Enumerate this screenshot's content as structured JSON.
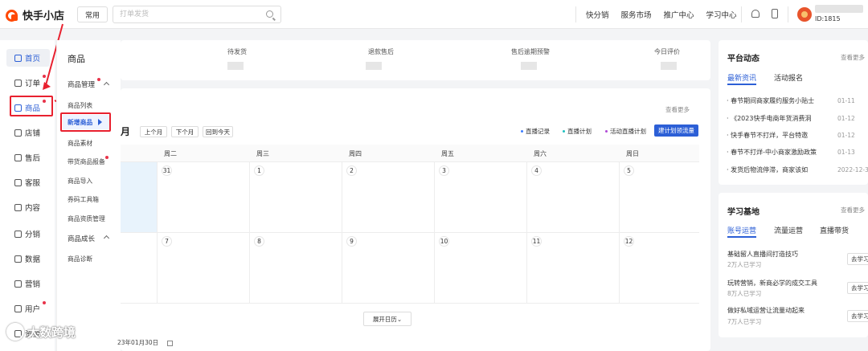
{
  "app": {
    "title": "快手小店"
  },
  "header": {
    "common_label": "常用",
    "search_placeholder": "打单发货",
    "nav": [
      "快分销",
      "服务市场",
      "推广中心",
      "学习中心"
    ],
    "user_id": "ID:1815"
  },
  "leftnav": {
    "items": [
      "首页",
      "订单",
      "商品",
      "店铺",
      "售后",
      "客服",
      "内容",
      "分销",
      "数据",
      "营销",
      "用户",
      "资金"
    ]
  },
  "subnav": {
    "title": "商品",
    "group1": "商品管理",
    "items1": [
      "商品列表",
      "新增商品",
      "商品素材",
      "带货商品报备",
      "商品导入",
      "券码工具箱",
      "商品资质管理"
    ],
    "group2": "商品成长",
    "items2": [
      "商品诊断"
    ]
  },
  "stats": {
    "labels": [
      "待发货",
      "退款售后",
      "售后逾期预警",
      "今日评价"
    ]
  },
  "calendar": {
    "see_more": "查看更多",
    "month": "月",
    "prev_month": "上个月",
    "next_month": "下个月",
    "today": "回到今天",
    "legend": [
      "直播记录",
      "直播计划",
      "活动直播计划"
    ],
    "create_btn": "建计划领流量",
    "weekdays": [
      "周二",
      "周三",
      "周四",
      "周五",
      "周六",
      "周日"
    ],
    "week1": [
      "31",
      "1",
      "2",
      "3",
      "4",
      "5"
    ],
    "week2": [
      "7",
      "8",
      "9",
      "10",
      "11",
      "12"
    ],
    "expand": "展开日历",
    "footer_date": "23年01月30日"
  },
  "platform": {
    "title": "平台动态",
    "more": "查看更多",
    "tabs": [
      "最新资讯",
      "活动报名"
    ],
    "news": [
      {
        "title": "春节期间商家履约服务小贴士",
        "date": "01-11"
      },
      {
        "title": "《2023快手电商年货消费洞",
        "date": "01-12"
      },
      {
        "title": "快手春节不打烊，平台特邀",
        "date": "01-12"
      },
      {
        "title": "春节不打烊-中小商家激励政策",
        "date": "01-13"
      },
      {
        "title": "发货后物流停滞，商家该如",
        "date": "2022-12-30"
      }
    ]
  },
  "learn": {
    "title": "学习基地",
    "more": "查看更多",
    "tabs": [
      "账号运营",
      "流量运营",
      "直播带货"
    ],
    "courses": [
      {
        "title": "基础留人直播间打造技巧",
        "sub": "2万人已学习",
        "btn": "去学习"
      },
      {
        "title": "玩转营销，新商必学的成交工具",
        "sub": "8万人已学习",
        "btn": "去学习"
      },
      {
        "title": "做好私域运营让流量动起来",
        "sub": "7万人已学习",
        "btn": "去学习"
      }
    ]
  },
  "watermark": "大数跨境",
  "colors": {
    "brand": "#ff4906",
    "primary": "#2c5fd6",
    "highlight": "#e8212f"
  }
}
